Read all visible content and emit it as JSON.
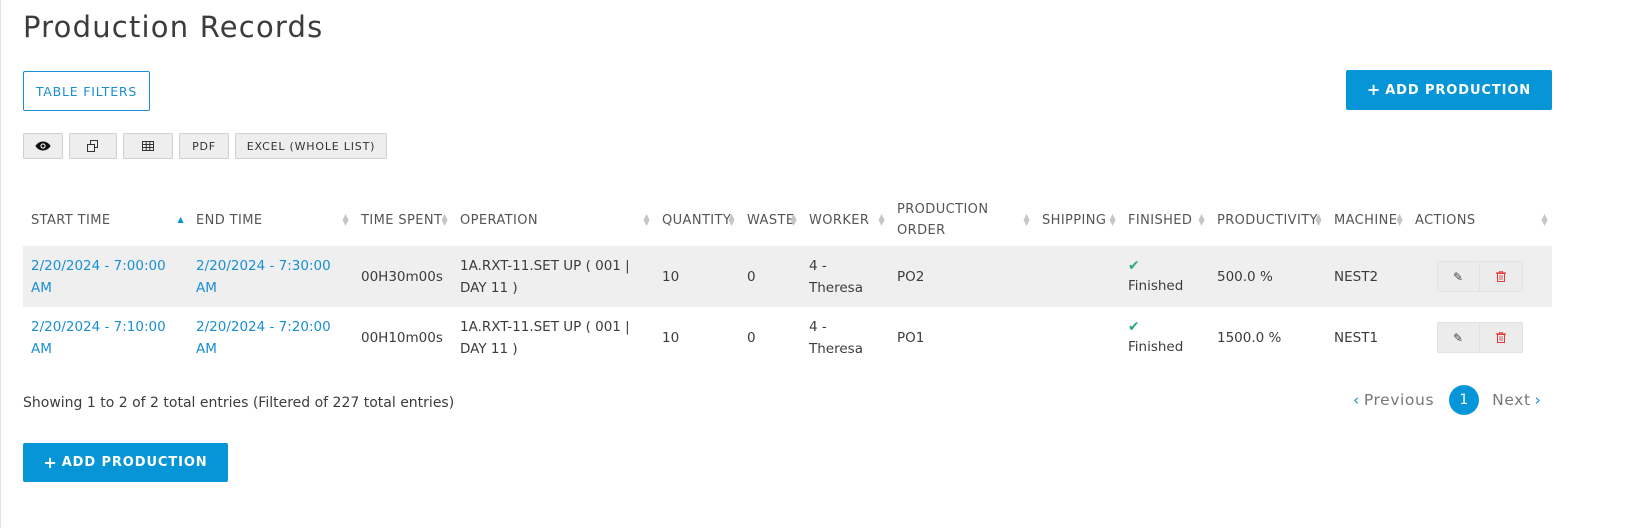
{
  "page": {
    "title": "Production Records"
  },
  "toolbar": {
    "filters_label": "TABLE FILTERS",
    "add_label": "ADD PRODUCTION",
    "add_icon": "plus-icon"
  },
  "export": {
    "buttons": [
      {
        "icon": "eye-icon",
        "label": ""
      },
      {
        "icon": "copy-icon",
        "label": ""
      },
      {
        "icon": "table-icon",
        "label": ""
      },
      {
        "icon": "",
        "label": "PDF"
      },
      {
        "icon": "",
        "label": "EXCEL (WHOLE LIST)"
      }
    ]
  },
  "table": {
    "columns": [
      {
        "label": "START TIME",
        "sort": "asc"
      },
      {
        "label": "END TIME",
        "sort": "none"
      },
      {
        "label": "TIME SPENT",
        "sort": "none"
      },
      {
        "label": "OPERATION",
        "sort": "none"
      },
      {
        "label": "QUANTITY",
        "sort": "none"
      },
      {
        "label": "WASTE",
        "sort": "none"
      },
      {
        "label": "WORKER",
        "sort": "none"
      },
      {
        "label": "PRODUCTION ORDER",
        "sort": "none"
      },
      {
        "label": "SHIPPING",
        "sort": "none"
      },
      {
        "label": "FINISHED",
        "sort": "none"
      },
      {
        "label": "PRODUCTIVITY",
        "sort": "none"
      },
      {
        "label": "MACHINE",
        "sort": "none"
      },
      {
        "label": "ACTIONS",
        "sort": "none"
      }
    ],
    "rows": [
      {
        "start_time": "2/20/2024 - 7:00:00 AM",
        "end_time": "2/20/2024 - 7:30:00 AM",
        "time_spent": "00H30m00s",
        "operation": "1A.RXT-11.SET UP ( 001 | DAY 11 )",
        "quantity": "10",
        "waste": "0",
        "worker": "4 - Theresa",
        "production_order": "PO2",
        "shipping": "",
        "finished": "Finished",
        "productivity": "500.0 %",
        "machine": "NEST2"
      },
      {
        "start_time": "2/20/2024 - 7:10:00 AM",
        "end_time": "2/20/2024 - 7:20:00 AM",
        "time_spent": "00H10m00s",
        "operation": "1A.RXT-11.SET UP ( 001 | DAY 11 )",
        "quantity": "10",
        "waste": "0",
        "worker": "4 - Theresa",
        "production_order": "PO1",
        "shipping": "",
        "finished": "Finished",
        "productivity": "1500.0 %",
        "machine": "NEST1"
      }
    ]
  },
  "footer": {
    "info": "Showing 1 to 2 of 2 total entries (Filtered of 227 total entries)"
  },
  "pagination": {
    "prev_label": "Previous",
    "next_label": "Next",
    "current_page": "1"
  },
  "colors": {
    "primary": "#0696d7",
    "link": "#1a8fd3",
    "success": "#2bab7b",
    "danger": "#e03b3b"
  }
}
